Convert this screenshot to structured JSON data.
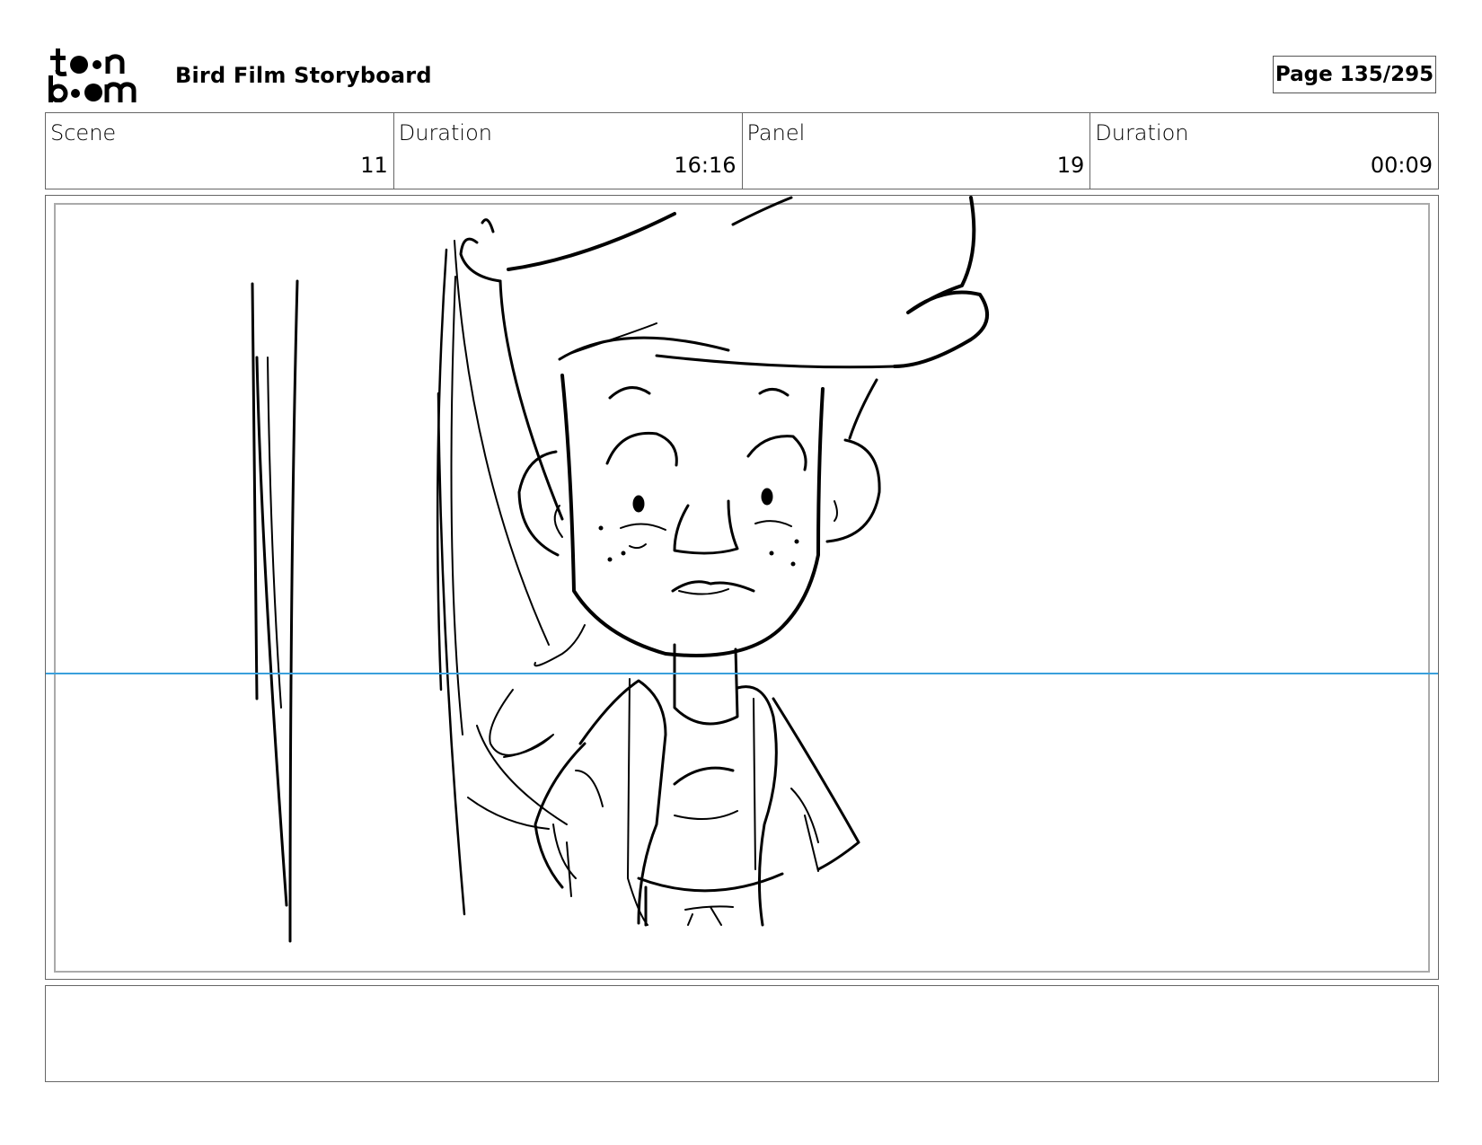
{
  "header": {
    "logo_text": "toon boom",
    "title": "Bird Film Storyboard",
    "page": "Page 135/295"
  },
  "info": [
    {
      "label": "Scene",
      "value": "11"
    },
    {
      "label": "Duration",
      "value": "16:16"
    },
    {
      "label": "Panel",
      "value": "19"
    },
    {
      "label": "Duration",
      "value": "00:09"
    }
  ],
  "panel": {
    "guide_line_color": "#3aa0dc",
    "sketch_subject": "character-sketch"
  },
  "notes": ""
}
